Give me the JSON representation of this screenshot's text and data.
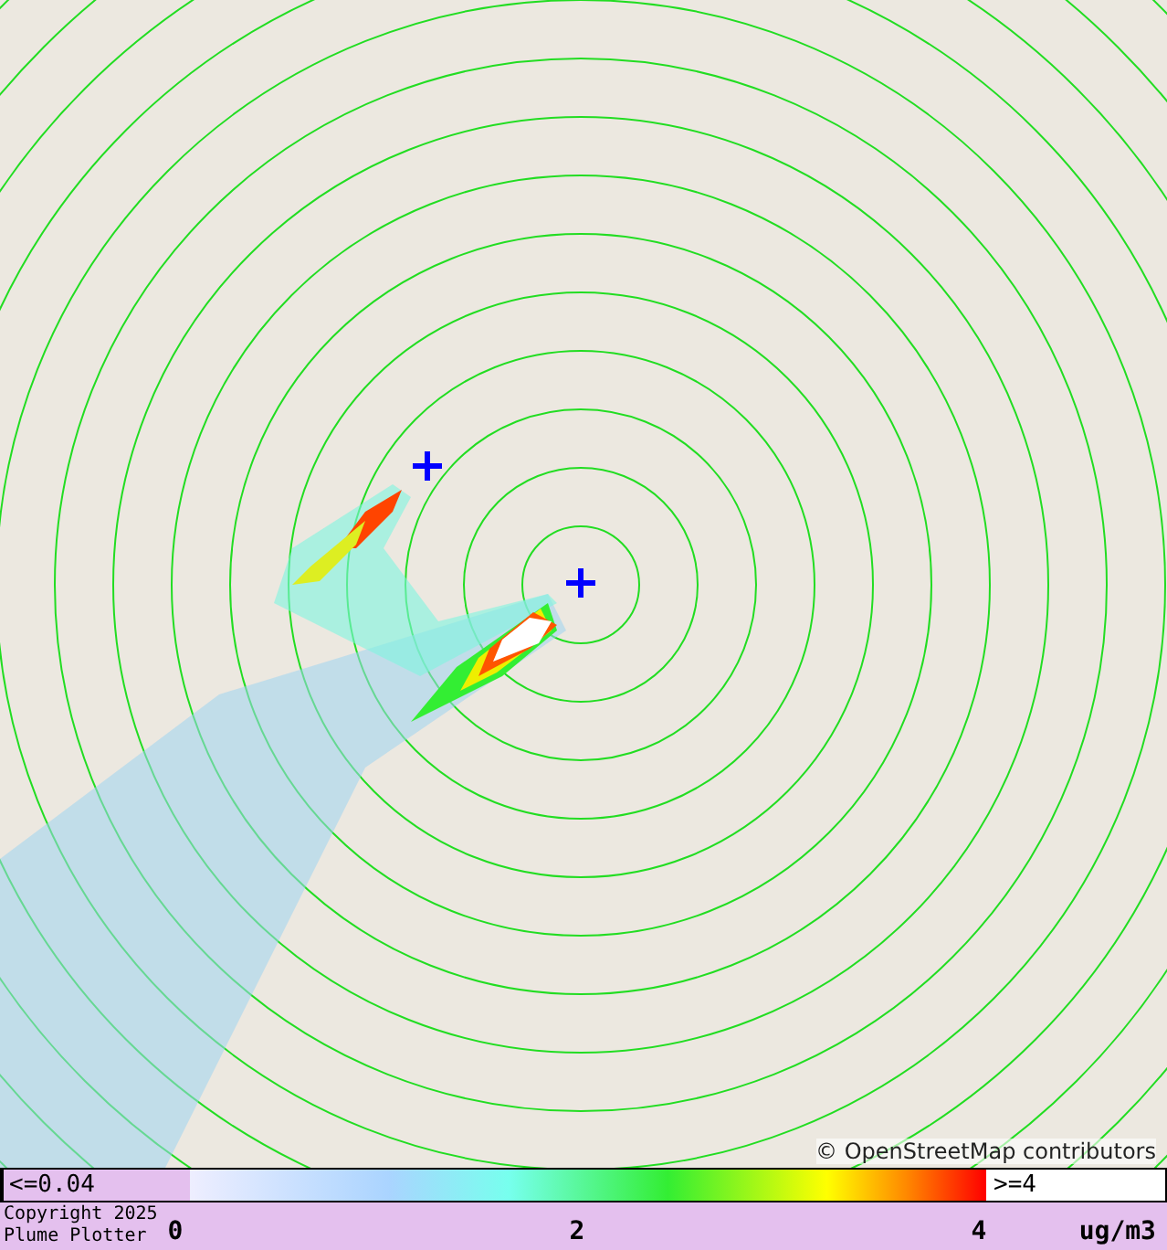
{
  "map": {
    "attribution": "© OpenStreetMap contributors"
  },
  "legend": {
    "low_label": "<=0.04",
    "high_label": ">=4",
    "ticks": [
      "0",
      "2",
      "4"
    ],
    "unit": "ug/m3",
    "copyright": [
      "Copyright 2025",
      "Plume Plotter"
    ]
  }
}
